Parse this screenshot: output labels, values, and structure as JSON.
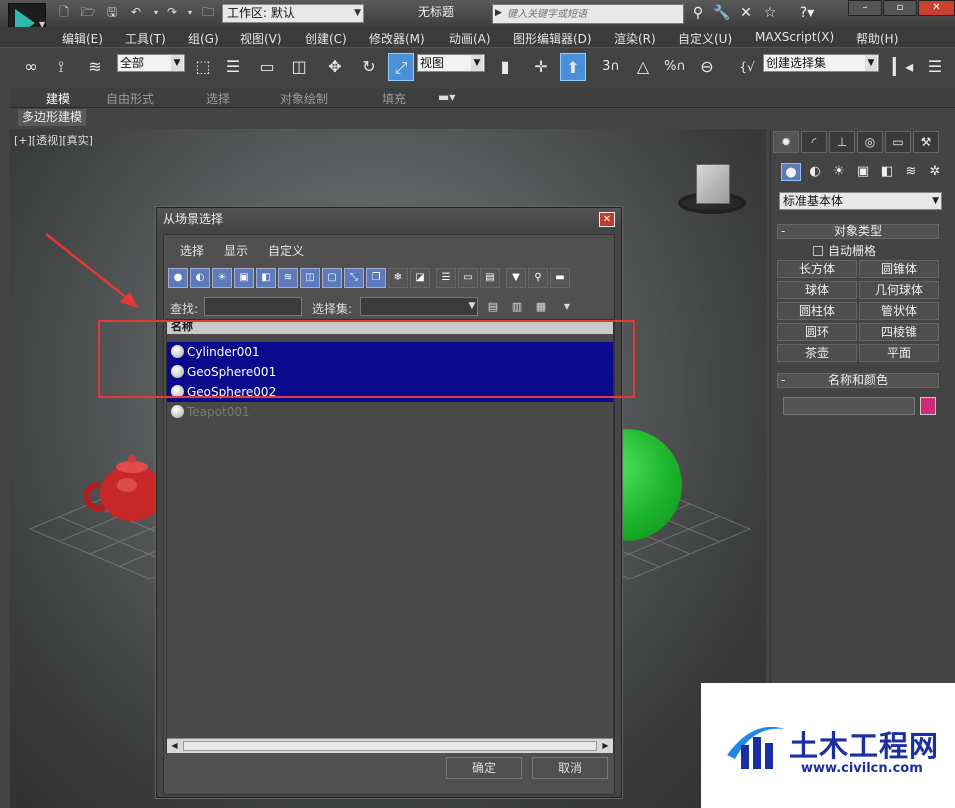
{
  "titlebar": {
    "workspace_label": "工作区: 默认",
    "doc_title": "无标题",
    "search_placeholder": "键入关键字或短语"
  },
  "menubar": [
    "编辑(E)",
    "工具(T)",
    "组(G)",
    "视图(V)",
    "创建(C)",
    "修改器(M)",
    "动画(A)",
    "图形编辑器(D)",
    "渲染(R)",
    "自定义(U)",
    "MAXScript(X)",
    "帮助(H)"
  ],
  "toolbar": {
    "filter_value": "全部",
    "refcoord_value": "视图",
    "named_selection_placeholder": "创建选择集",
    "snap_labels": [
      "3",
      "%",
      "n"
    ]
  },
  "ribbon": {
    "tabs": [
      "建模",
      "自由形式",
      "选择",
      "对象绘制",
      "填充"
    ],
    "active_tab": "建模",
    "sub_label": "多边形建模"
  },
  "viewport": {
    "label": "[+][透视][真实]"
  },
  "dialog": {
    "title": "从场景选择",
    "menus": [
      "选择",
      "显示",
      "自定义"
    ],
    "find_label": "查找:",
    "selset_label": "选择集:",
    "column_header": "名称",
    "objects": [
      {
        "name": "Cylinder001",
        "selected": true
      },
      {
        "name": "GeoSphere001",
        "selected": true
      },
      {
        "name": "GeoSphere002",
        "selected": true
      },
      {
        "name": "Teapot001",
        "selected": false
      }
    ],
    "ok_label": "确定",
    "cancel_label": "取消"
  },
  "command_panel": {
    "category": "标准基本体",
    "rollout_object_type": "对象类型",
    "autogrid_label": "自动栅格",
    "object_buttons": [
      "长方体",
      "圆锥体",
      "球体",
      "几何球体",
      "圆柱体",
      "管状体",
      "圆环",
      "四棱锥",
      "茶壶",
      "平面"
    ],
    "rollout_name_color": "名称和颜色",
    "object_color": "#cc2a7a"
  },
  "colors": {
    "selection_highlight": "#0a0a8c",
    "annotation_red": "#e53935",
    "teapot": "#c62828",
    "sphere": "#1db52c"
  },
  "watermark": {
    "text": "土木工程网",
    "url": "www.civilcn.com"
  }
}
